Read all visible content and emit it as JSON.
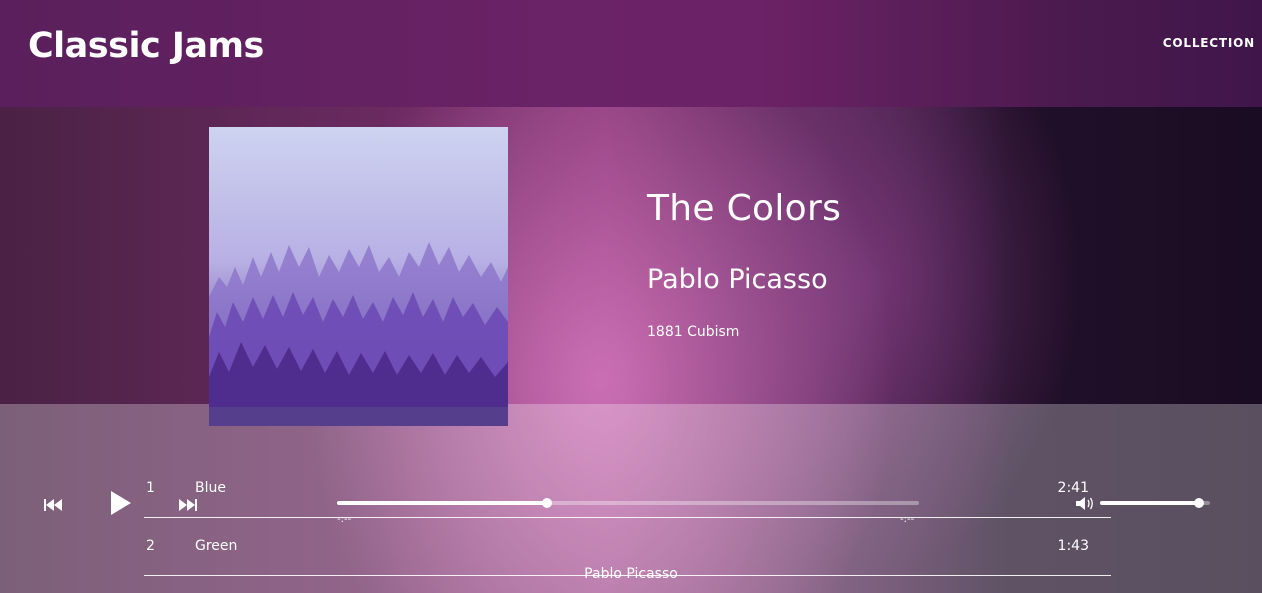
{
  "header": {
    "brand": "Classic Jams",
    "nav": {
      "collection": "COLLECTION"
    }
  },
  "album": {
    "title": "The Colors",
    "artist": "Pablo Picasso",
    "meta": "1881 Cubism",
    "cover_icon": "forest-image"
  },
  "tracks": [
    {
      "number": "1",
      "name": "Blue",
      "duration": "2:41"
    },
    {
      "number": "2",
      "name": "Green",
      "duration": "1:43"
    }
  ],
  "player": {
    "seek_fraction": 0.36,
    "volume_fraction": 0.9,
    "current_time": "-:--",
    "total_time": "-:--",
    "artist": "Pablo Picasso"
  },
  "colors": {
    "header": "#5a1f5c",
    "accent": "#c37ab8"
  }
}
